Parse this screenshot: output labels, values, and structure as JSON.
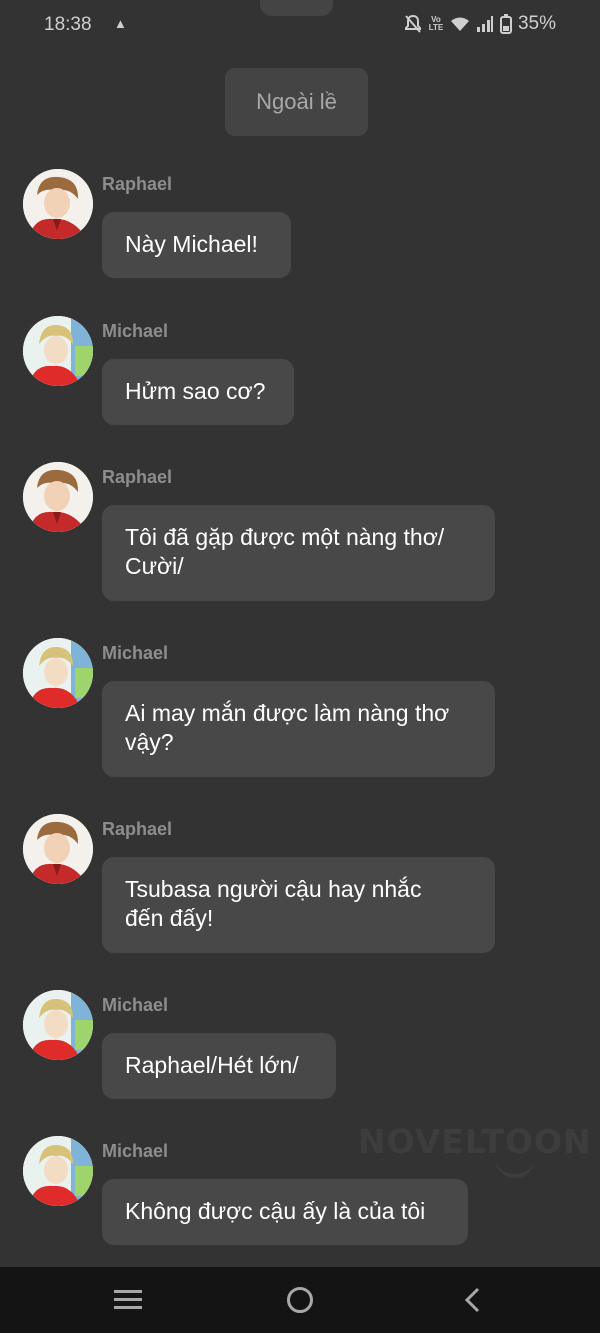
{
  "status_bar": {
    "time": "18:38",
    "battery": "35%",
    "icons": [
      "notification-app-icon",
      "bell-off-icon",
      "volte-icon",
      "wifi-icon",
      "signal-icon",
      "battery-icon"
    ]
  },
  "aside_label": "Ngoài lề",
  "messages": [
    {
      "sender": "Raphael",
      "lines": [
        "Này Michael!"
      ]
    },
    {
      "sender": "Michael",
      "lines": [
        "Hửm sao cơ?"
      ]
    },
    {
      "sender": "Raphael",
      "lines": [
        "Tôi đã gặp được một nàng thơ/",
        "Cười/"
      ]
    },
    {
      "sender": "Michael",
      "lines": [
        "Ai may mắn được làm nàng thơ",
        "vậy?"
      ]
    },
    {
      "sender": "Raphael",
      "lines": [
        "Tsubasa người cậu hay nhắc",
        "đến đấy!"
      ]
    },
    {
      "sender": "Michael",
      "lines": [
        "Raphael/Hét lớn/"
      ]
    },
    {
      "sender": "Michael",
      "lines": [
        "Không được cậu ấy là của tôi"
      ]
    }
  ],
  "watermark": "NOVELTOON",
  "nav_bar": {
    "icons": [
      "menu-icon",
      "home-icon",
      "back-icon"
    ]
  },
  "colors": {
    "background": "#333333",
    "bubble": "#484848",
    "sender": "#8d8d8d",
    "nav": "#141414"
  }
}
